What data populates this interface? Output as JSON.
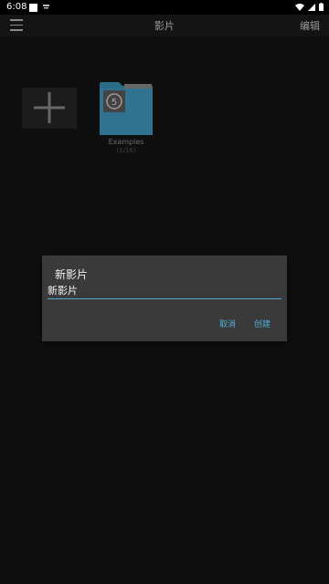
{
  "status_bar": {
    "time": "6:08",
    "icons": [
      "notification-square-icon",
      "wifi-icon",
      "signal-icon",
      "battery-icon"
    ]
  },
  "app_bar": {
    "title": "影片",
    "edit_label": "编辑"
  },
  "grid": {
    "folder": {
      "name": "Examples",
      "count": "(1/16)"
    }
  },
  "dialog": {
    "title": "新影片",
    "input_value": "新影片",
    "cancel_label": "取消",
    "create_label": "创建"
  },
  "colors": {
    "accent": "#4fb0d8",
    "background": "#141414",
    "dialog_bg": "#3a3a3a",
    "folder": "#3a8fb5"
  }
}
